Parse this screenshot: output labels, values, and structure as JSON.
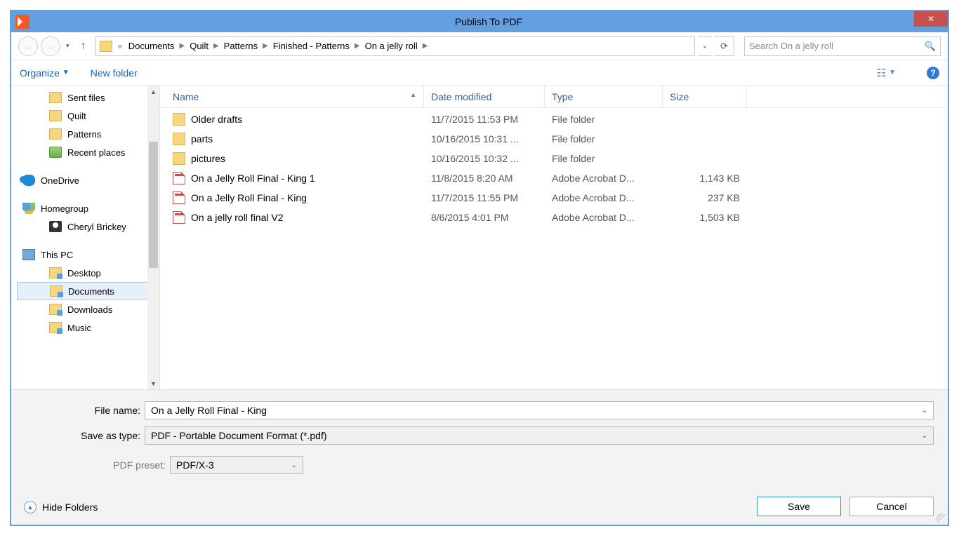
{
  "window": {
    "title": "Publish To PDF"
  },
  "breadcrumb": {
    "prefix": "«",
    "items": [
      "Documents",
      "Quilt",
      "Patterns",
      "Finished - Patterns",
      "On a jelly roll"
    ]
  },
  "search": {
    "placeholder": "Search On a jelly roll"
  },
  "toolbar": {
    "organize": "Organize",
    "newFolder": "New folder"
  },
  "sidebar": {
    "items": [
      {
        "label": "Sent files",
        "icon": "folder",
        "indent": 1
      },
      {
        "label": "Quilt",
        "icon": "folder",
        "indent": 1
      },
      {
        "label": "Patterns",
        "icon": "folder",
        "indent": 1
      },
      {
        "label": "Recent places",
        "icon": "recent",
        "indent": 1
      },
      {
        "spacer": true
      },
      {
        "label": "OneDrive",
        "icon": "onedrive",
        "indent": 0
      },
      {
        "spacer": true
      },
      {
        "label": "Homegroup",
        "icon": "homegroup",
        "indent": 0
      },
      {
        "label": "Cheryl Brickey",
        "icon": "contact",
        "indent": 1
      },
      {
        "spacer": true
      },
      {
        "label": "This PC",
        "icon": "pc",
        "indent": 0
      },
      {
        "label": "Desktop",
        "icon": "folder-sp",
        "indent": 1
      },
      {
        "label": "Documents",
        "icon": "folder-sp",
        "indent": 1,
        "selected": true
      },
      {
        "label": "Downloads",
        "icon": "folder-sp",
        "indent": 1
      },
      {
        "label": "Music",
        "icon": "folder-sp",
        "indent": 1
      }
    ]
  },
  "columns": {
    "name": "Name",
    "date": "Date modified",
    "type": "Type",
    "size": "Size"
  },
  "files": [
    {
      "name": "Older drafts",
      "date": "11/7/2015 11:53 PM",
      "type": "File folder",
      "size": "",
      "icon": "folder"
    },
    {
      "name": "parts",
      "date": "10/16/2015 10:31 ...",
      "type": "File folder",
      "size": "",
      "icon": "folder"
    },
    {
      "name": "pictures",
      "date": "10/16/2015 10:32 ...",
      "type": "File folder",
      "size": "",
      "icon": "folder"
    },
    {
      "name": "On a Jelly Roll Final - King 1",
      "date": "11/8/2015 8:20 AM",
      "type": "Adobe Acrobat D...",
      "size": "1,143 KB",
      "icon": "pdf"
    },
    {
      "name": "On a Jelly Roll Final - King",
      "date": "11/7/2015 11:55 PM",
      "type": "Adobe Acrobat D...",
      "size": "237 KB",
      "icon": "pdf"
    },
    {
      "name": "On a jelly roll final V2",
      "date": "8/6/2015 4:01 PM",
      "type": "Adobe Acrobat D...",
      "size": "1,503 KB",
      "icon": "pdf"
    }
  ],
  "bottom": {
    "fileNameLabel": "File name:",
    "fileNameValue": "On a Jelly Roll Final - King",
    "saveTypeLabel": "Save as type:",
    "saveTypeValue": "PDF - Portable Document Format (*.pdf)",
    "pdfPresetLabel": "PDF preset:",
    "pdfPresetValue": "PDF/X-3",
    "hideFolders": "Hide Folders",
    "save": "Save",
    "cancel": "Cancel"
  }
}
